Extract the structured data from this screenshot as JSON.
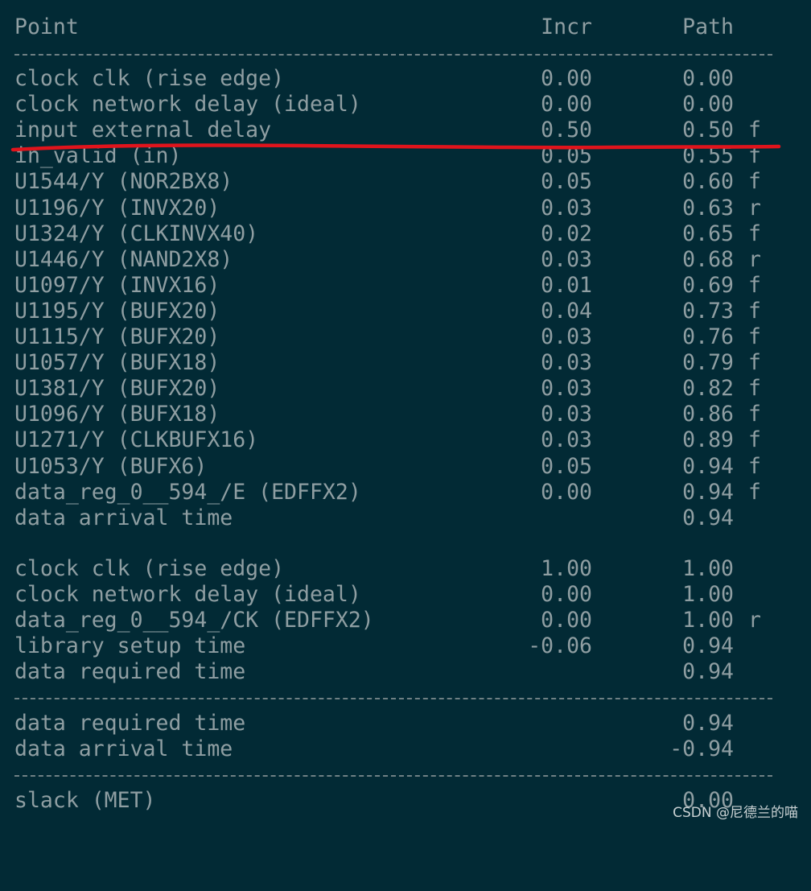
{
  "header": {
    "point": "Point",
    "incr": "Incr",
    "path": "Path"
  },
  "arrival_rows": [
    {
      "point": "clock clk (rise edge)",
      "incr": "0.00",
      "path": "0.00",
      "flag": ""
    },
    {
      "point": "clock network delay (ideal)",
      "incr": "0.00",
      "path": "0.00",
      "flag": ""
    },
    {
      "point": "input external delay",
      "incr": "0.50",
      "path": "0.50",
      "flag": "f"
    },
    {
      "point": "in_valid (in)",
      "incr": "0.05",
      "path": "0.55",
      "flag": "f"
    },
    {
      "point": "U1544/Y (NOR2BX8)",
      "incr": "0.05",
      "path": "0.60",
      "flag": "f"
    },
    {
      "point": "U1196/Y (INVX20)",
      "incr": "0.03",
      "path": "0.63",
      "flag": "r"
    },
    {
      "point": "U1324/Y (CLKINVX40)",
      "incr": "0.02",
      "path": "0.65",
      "flag": "f"
    },
    {
      "point": "U1446/Y (NAND2X8)",
      "incr": "0.03",
      "path": "0.68",
      "flag": "r"
    },
    {
      "point": "U1097/Y (INVX16)",
      "incr": "0.01",
      "path": "0.69",
      "flag": "f"
    },
    {
      "point": "U1195/Y (BUFX20)",
      "incr": "0.04",
      "path": "0.73",
      "flag": "f"
    },
    {
      "point": "U1115/Y (BUFX20)",
      "incr": "0.03",
      "path": "0.76",
      "flag": "f"
    },
    {
      "point": "U1057/Y (BUFX18)",
      "incr": "0.03",
      "path": "0.79",
      "flag": "f"
    },
    {
      "point": "U1381/Y (BUFX20)",
      "incr": "0.03",
      "path": "0.82",
      "flag": "f"
    },
    {
      "point": "U1096/Y (BUFX18)",
      "incr": "0.03",
      "path": "0.86",
      "flag": "f"
    },
    {
      "point": "U1271/Y (CLKBUFX16)",
      "incr": "0.03",
      "path": "0.89",
      "flag": "f"
    },
    {
      "point": "U1053/Y (BUFX6)",
      "incr": "0.05",
      "path": "0.94",
      "flag": "f"
    },
    {
      "point": "data_reg_0__594_/E (EDFFX2)",
      "incr": "0.00",
      "path": "0.94",
      "flag": "f"
    },
    {
      "point": "data arrival time",
      "incr": "",
      "path": "0.94",
      "flag": ""
    }
  ],
  "required_rows": [
    {
      "point": "clock clk (rise edge)",
      "incr": "1.00",
      "path": "1.00",
      "flag": ""
    },
    {
      "point": "clock network delay (ideal)",
      "incr": "0.00",
      "path": "1.00",
      "flag": ""
    },
    {
      "point": "data_reg_0__594_/CK (EDFFX2)",
      "incr": "0.00",
      "path": "1.00",
      "flag": "r"
    },
    {
      "point": "library setup time",
      "incr": "-0.06",
      "path": "0.94",
      "flag": ""
    },
    {
      "point": "data required time",
      "incr": "",
      "path": "0.94",
      "flag": ""
    }
  ],
  "summary_rows": [
    {
      "point": "data required time",
      "incr": "",
      "path": "0.94",
      "flag": ""
    },
    {
      "point": "data arrival time",
      "incr": "",
      "path": "-0.94",
      "flag": ""
    }
  ],
  "slack_row": {
    "point": "slack (MET)",
    "incr": "",
    "path": "0.00",
    "flag": ""
  },
  "annotation": {
    "color": "#e0141c",
    "label": "underline-marker"
  },
  "watermark": "CSDN @尼德兰的喵",
  "colors": {
    "background": "#022a35",
    "text": "#8f9ea2",
    "separator": "#6f8084"
  }
}
